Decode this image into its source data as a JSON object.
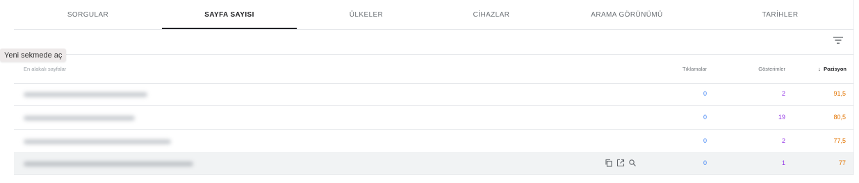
{
  "tabs": [
    {
      "label": "SORGULAR",
      "active": false
    },
    {
      "label": "SAYFA SAYISI",
      "active": true
    },
    {
      "label": "ÜLKELER",
      "active": false
    },
    {
      "label": "CİHAZLAR",
      "active": false
    },
    {
      "label": "ARAMA GÖRÜNÜMÜ",
      "active": false
    },
    {
      "label": "TARİHLER",
      "active": false
    }
  ],
  "tooltip": "Yeni sekmede aç",
  "table": {
    "headers": {
      "pages": "En alakalı sayfalar",
      "clicks": "Tıklamalar",
      "impressions": "Gösterimler",
      "position": "Pozisyon"
    },
    "sort_arrow": "↓",
    "rows": [
      {
        "clicks": "0",
        "impressions": "2",
        "position": "91,5"
      },
      {
        "clicks": "0",
        "impressions": "19",
        "position": "80,5"
      },
      {
        "clicks": "0",
        "impressions": "2",
        "position": "77,5"
      },
      {
        "clicks": "0",
        "impressions": "1",
        "position": "77"
      }
    ]
  },
  "colors": {
    "clicks": "#4285f4",
    "impressions": "#9334e6",
    "position": "#e37400",
    "active_tab": "#202124"
  },
  "icons": [
    "filter-icon",
    "copy-icon",
    "open-in-new-icon",
    "search-icon"
  ]
}
